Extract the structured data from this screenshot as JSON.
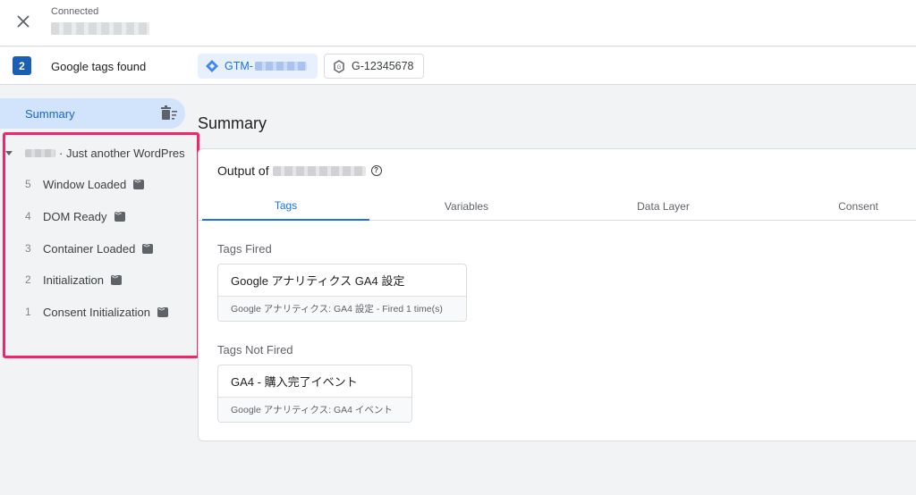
{
  "topbar": {
    "connection_label": "Connected"
  },
  "tags_bar": {
    "count": "2",
    "label": "Google tags found",
    "gtm_chip": "GTM-",
    "ga_chip": "G-12345678"
  },
  "sidebar": {
    "summary_label": "Summary",
    "page_title": "· Just another WordPres",
    "events": [
      {
        "num": "5",
        "name": "Window Loaded"
      },
      {
        "num": "4",
        "name": "DOM Ready"
      },
      {
        "num": "3",
        "name": "Container Loaded"
      },
      {
        "num": "2",
        "name": "Initialization"
      },
      {
        "num": "1",
        "name": "Consent Initialization"
      }
    ]
  },
  "main": {
    "title": "Summary",
    "output_label": "Output of",
    "help_glyph": "?",
    "tabs": [
      "Tags",
      "Variables",
      "Data Layer",
      "Consent"
    ],
    "tags_fired_label": "Tags Fired",
    "fired_tags": [
      {
        "name": "Google アナリティクス GA4 設定",
        "detail": "Google アナリティクス: GA4 設定 - Fired 1 time(s)"
      }
    ],
    "tags_not_fired_label": "Tags Not Fired",
    "not_fired_tags": [
      {
        "name": "GA4 - 購入完了イベント",
        "detail": "Google アナリティクス: GA4 イベント"
      }
    ]
  },
  "colors": {
    "accent": "#1a73e8",
    "highlight_border": "#f0266b",
    "summary_bg": "#d2e3fc",
    "badge_bg": "#1a5fb4"
  },
  "icons": [
    "close-icon",
    "gtm-diamond-icon",
    "google-tag-icon",
    "trash-icon",
    "code-icon",
    "help-icon",
    "caret-down-icon"
  ]
}
